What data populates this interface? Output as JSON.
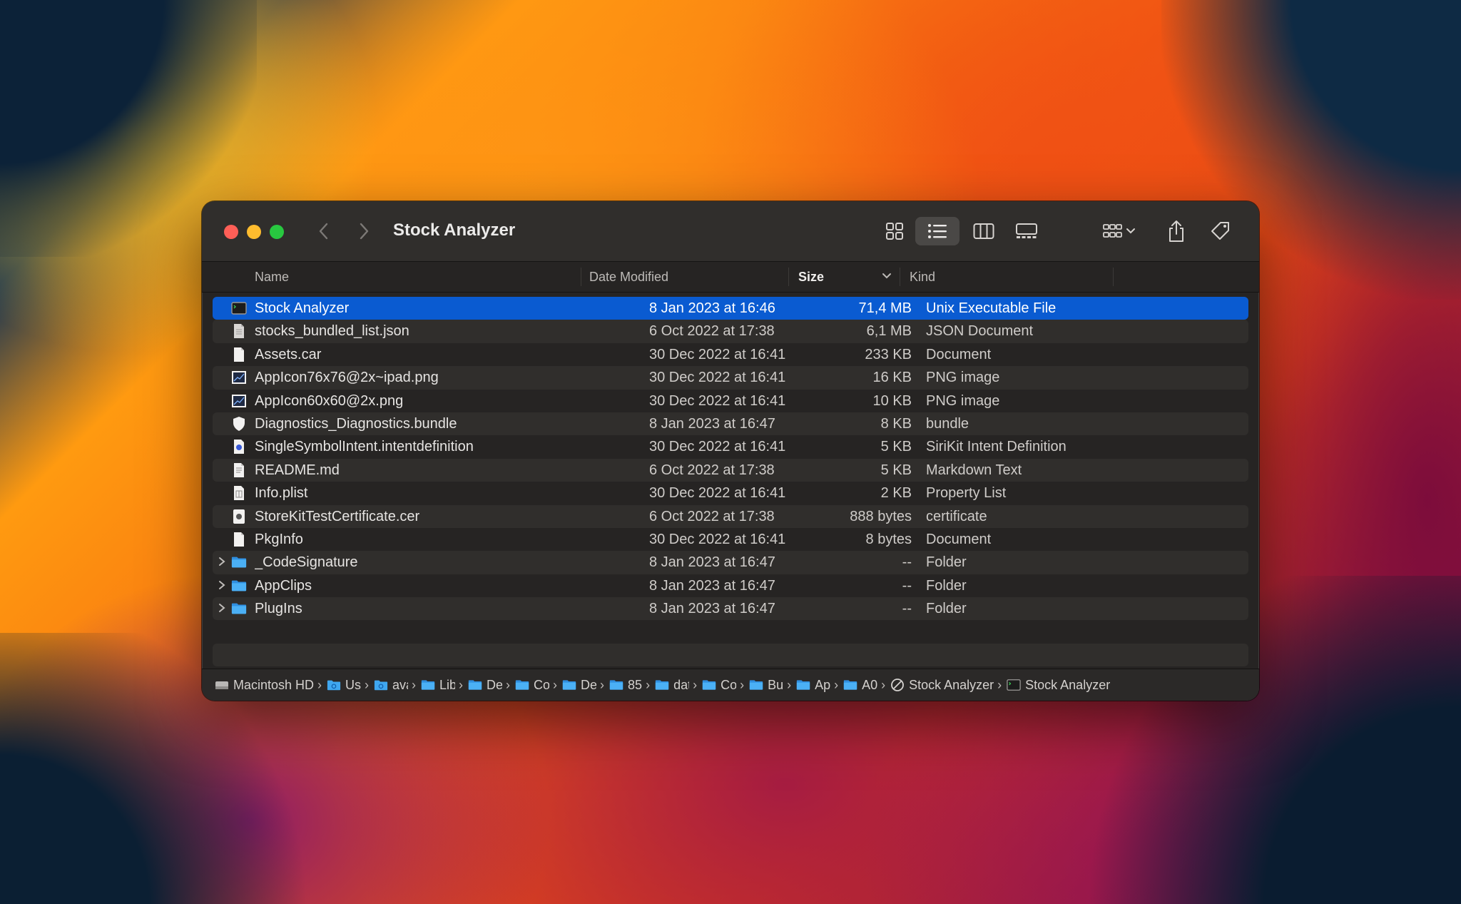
{
  "window": {
    "title": "Stock Analyzer"
  },
  "toolbar": {
    "items": [
      {
        "name": "icon-view",
        "icon": "grid-icon"
      },
      {
        "name": "list-view",
        "icon": "list-icon",
        "selected": true
      },
      {
        "name": "column-view",
        "icon": "columns-icon"
      },
      {
        "name": "gallery-view",
        "icon": "gallery-icon"
      },
      {
        "name": "group-menu",
        "icon": "group-icon"
      },
      {
        "name": "share",
        "icon": "share-icon"
      },
      {
        "name": "tags",
        "icon": "tag-icon"
      },
      {
        "name": "action-menu",
        "icon": "ellipsis-circle-icon"
      },
      {
        "name": "dropbox-menu",
        "icon": "dropbox-icon"
      },
      {
        "name": "search",
        "icon": "search-icon"
      }
    ]
  },
  "columns": {
    "name": "Name",
    "date": "Date Modified",
    "size": "Size",
    "kind": "Kind",
    "sorted_by": "Size",
    "sort_direction": "descending"
  },
  "files": [
    {
      "name": "Stock Analyzer",
      "date": "8 Jan 2023 at 16:46",
      "size": "71,4 MB",
      "kind": "Unix Executable File",
      "icon": "terminal-icon",
      "selected": true
    },
    {
      "name": "stocks_bundled_list.json",
      "date": "6 Oct 2022 at 17:38",
      "size": "6,1 MB",
      "kind": "JSON Document",
      "icon": "document-icon"
    },
    {
      "name": "Assets.car",
      "date": "30 Dec 2022 at 16:41",
      "size": "233 KB",
      "kind": "Document",
      "icon": "blank-document-icon"
    },
    {
      "name": "AppIcon76x76@2x~ipad.png",
      "date": "30 Dec 2022 at 16:41",
      "size": "16 KB",
      "kind": "PNG image",
      "icon": "image-icon"
    },
    {
      "name": "AppIcon60x60@2x.png",
      "date": "30 Dec 2022 at 16:41",
      "size": "10 KB",
      "kind": "PNG image",
      "icon": "image-icon"
    },
    {
      "name": "Diagnostics_Diagnostics.bundle",
      "date": "8 Jan 2023 at 16:47",
      "size": "8 KB",
      "kind": "bundle",
      "icon": "shield-icon"
    },
    {
      "name": "SingleSymbolIntent.intentdefinition",
      "date": "30 Dec 2022 at 16:41",
      "size": "5 KB",
      "kind": "SiriKit Intent Definition",
      "icon": "intent-icon"
    },
    {
      "name": "README.md",
      "date": "6 Oct 2022 at 17:38",
      "size": "5 KB",
      "kind": "Markdown Text",
      "icon": "text-document-icon"
    },
    {
      "name": "Info.plist",
      "date": "30 Dec 2022 at 16:41",
      "size": "2 KB",
      "kind": "Property List",
      "icon": "plist-icon"
    },
    {
      "name": "StoreKitTestCertificate.cer",
      "date": "6 Oct 2022 at 17:38",
      "size": "888 bytes",
      "kind": "certificate",
      "icon": "certificate-icon"
    },
    {
      "name": "PkgInfo",
      "date": "30 Dec 2022 at 16:41",
      "size": "8 bytes",
      "kind": "Document",
      "icon": "blank-document-icon"
    },
    {
      "name": "_CodeSignature",
      "date": "8 Jan 2023 at 16:47",
      "size": "--",
      "kind": "Folder",
      "icon": "folder-icon",
      "expandable": true
    },
    {
      "name": "AppClips",
      "date": "8 Jan 2023 at 16:47",
      "size": "--",
      "kind": "Folder",
      "icon": "folder-icon",
      "expandable": true
    },
    {
      "name": "PlugIns",
      "date": "8 Jan 2023 at 16:47",
      "size": "--",
      "kind": "Folder",
      "icon": "folder-icon",
      "expandable": true
    }
  ],
  "pathbar": [
    {
      "label": "Macintosh HD",
      "icon": "disk-icon"
    },
    {
      "label": "Us",
      "icon": "home-folder-icon",
      "truncated": true
    },
    {
      "label": "ava",
      "icon": "home-folder-icon",
      "truncated": true
    },
    {
      "label": "Lib",
      "icon": "folder-icon",
      "truncated": true
    },
    {
      "label": "De",
      "icon": "folder-icon",
      "truncated": true
    },
    {
      "label": "Co",
      "icon": "folder-icon",
      "truncated": true
    },
    {
      "label": "De",
      "icon": "folder-icon",
      "truncated": true
    },
    {
      "label": "85",
      "icon": "folder-icon",
      "truncated": true
    },
    {
      "label": "dat",
      "icon": "folder-icon",
      "truncated": true
    },
    {
      "label": "Co",
      "icon": "folder-icon",
      "truncated": true
    },
    {
      "label": "Bu",
      "icon": "folder-icon",
      "truncated": true
    },
    {
      "label": "Ap",
      "icon": "folder-icon",
      "truncated": true
    },
    {
      "label": "A0",
      "icon": "folder-icon",
      "truncated": true
    },
    {
      "label": "Stock Analyzer",
      "icon": "app-icon"
    },
    {
      "label": "Stock Analyzer",
      "icon": "terminal-icon"
    }
  ],
  "colors": {
    "selection": "#0a5bd1",
    "folder": "#3fa7f0",
    "close": "#ff5f57",
    "minimize": "#febc2e",
    "zoom": "#28c840"
  }
}
